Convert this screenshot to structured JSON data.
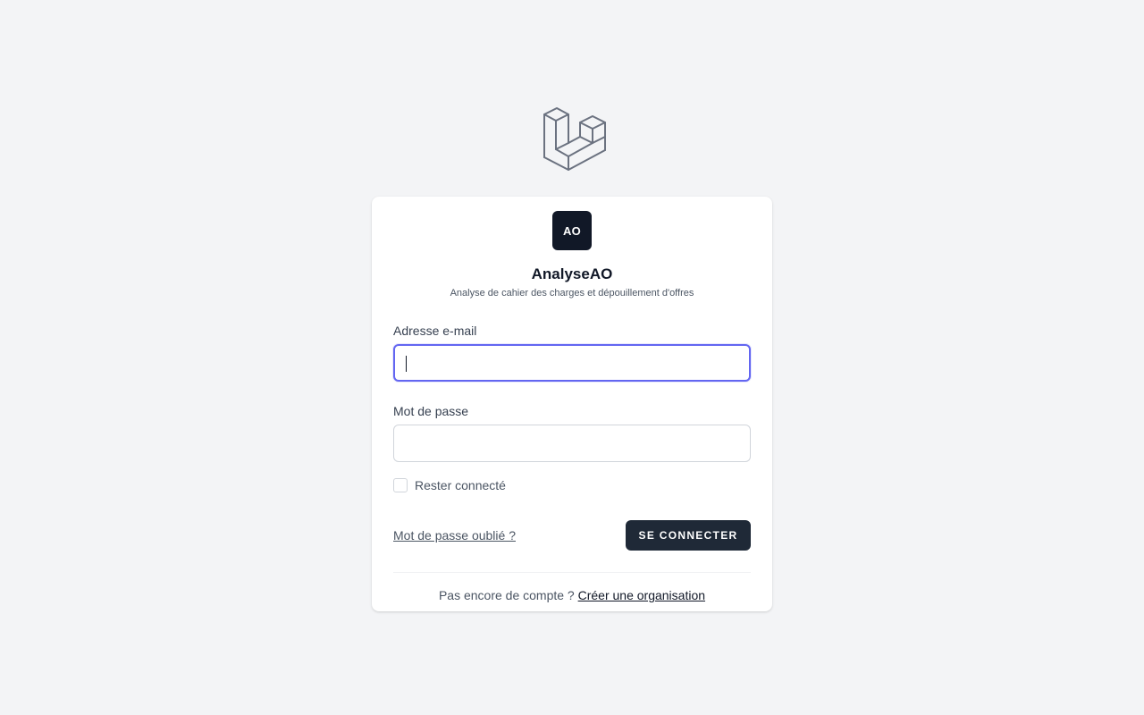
{
  "app": {
    "badge": "AO",
    "name": "AnalyseAO",
    "subtitle": "Analyse de cahier des charges et dépouillement d'offres"
  },
  "form": {
    "email_label": "Adresse e-mail",
    "email_value": "",
    "password_label": "Mot de passe",
    "password_value": "",
    "remember_label": "Rester connecté",
    "remember_checked": false,
    "forgot_link": "Mot de passe oublié ?",
    "submit_label": "Se connecter"
  },
  "signup": {
    "prompt": "Pas encore de compte ?",
    "link": "Créer une organisation"
  },
  "colors": {
    "background": "#f3f4f6",
    "primary_button": "#1f2937",
    "focus_ring": "#6366f1",
    "badge": "#111827",
    "logo_stroke": "#6b7280"
  },
  "icons": {
    "logo": "laravel-logo-icon"
  }
}
